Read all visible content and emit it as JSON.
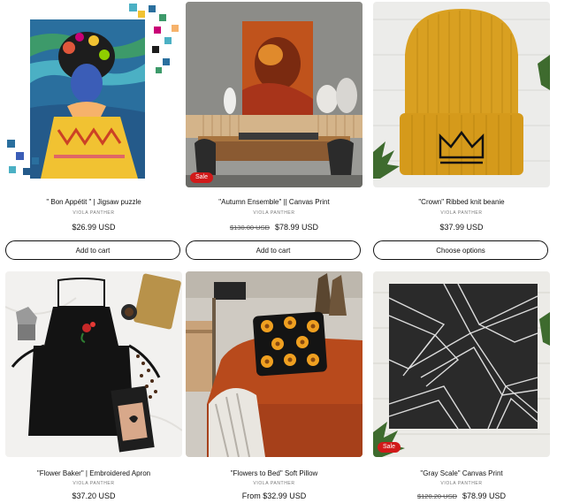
{
  "products": [
    {
      "title": "\" Bon Appétit \" | Jigsaw puzzle",
      "vendor": "VIOLA PANTHER",
      "price": "$26.99 USD",
      "compare_price": "",
      "badge": "",
      "button": "Add to cart"
    },
    {
      "title": "\"Autumn Ensemble\" || Canvas Print",
      "vendor": "VIOLA PANTHER",
      "price": "$78.99 USD",
      "compare_price": "$130.00 USD",
      "badge": "Sale",
      "button": "Add to cart"
    },
    {
      "title": "\"Crown\" Ribbed knit beanie",
      "vendor": "VIOLA PANTHER",
      "price": "$37.99 USD",
      "compare_price": "",
      "badge": "",
      "button": "Choose options"
    },
    {
      "title": "\"Flower Baker\" | Embroidered Apron",
      "vendor": "VIOLA PANTHER",
      "price": "$37.20 USD",
      "compare_price": "",
      "badge": ""
    },
    {
      "title": "\"Flowers to Bed\" Soft Pillow",
      "vendor": "VIOLA PANTHER",
      "price": "From $32.99 USD",
      "compare_price": "",
      "badge": ""
    },
    {
      "title": "\"Gray Scale\" Canvas Print",
      "vendor": "VIOLA PANTHER",
      "price": "$78.99 USD",
      "compare_price": "$120.20 USD",
      "badge": "Sale"
    }
  ],
  "colors": {
    "sale_badge": "#d11a1a",
    "text": "#121212",
    "vendor": "#777777",
    "beanie": "#d9a021"
  }
}
